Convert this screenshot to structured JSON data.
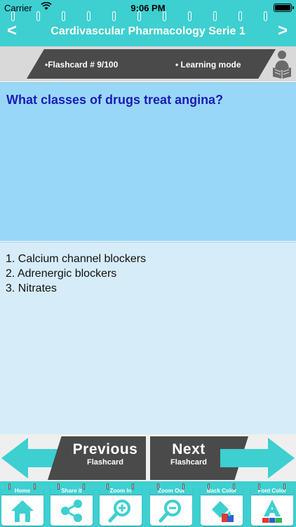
{
  "status_bar": {
    "carrier": "Carrier",
    "time": "9:06 PM"
  },
  "header": {
    "title": "Cardivascular Pharmacology Serie 1",
    "prev_arrow": "<",
    "next_arrow": ">"
  },
  "info": {
    "flashcard": "•Flashcard #  9/100",
    "mode": "• Learning mode"
  },
  "question": {
    "text": "What classes of drugs treat angina?"
  },
  "answer": {
    "lines": [
      "1. Calcium channel blockers",
      "2. Adrenergic blockers",
      "3. Nitrates"
    ]
  },
  "navigation": {
    "previous": {
      "title": "Previous",
      "subtitle": "Flashcard"
    },
    "next": {
      "title": "Next",
      "subtitle": "Flashcard"
    }
  },
  "toolbar": {
    "items": [
      {
        "label": "Home",
        "icon": "home-icon"
      },
      {
        "label": "Share it",
        "icon": "share-icon"
      },
      {
        "label": "Zoom In",
        "icon": "zoom-in-icon"
      },
      {
        "label": "Zoom Out",
        "icon": "zoom-out-icon"
      },
      {
        "label": "Back Color",
        "icon": "back-color-icon"
      },
      {
        "label": "Font Color",
        "icon": "font-color-icon"
      }
    ]
  },
  "colors": {
    "accent": "#3ecfd0",
    "question_bg": "#99d7f8",
    "answer_bg": "#d6ecf9",
    "question_text": "#1a1cb6",
    "dark_bar": "#4a4a4a"
  }
}
